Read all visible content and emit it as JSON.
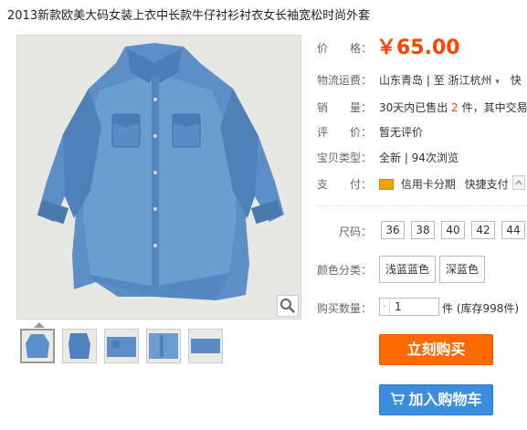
{
  "title": "2013新款欧美大码女装上衣中长款牛仔衬衫衬衣女长袖宽松时尚外套",
  "price": {
    "label": "价　　格：",
    "value": "￥65.00"
  },
  "shipping": {
    "label": "物流运费：",
    "value": "山东青岛 | 至 浙江杭州",
    "extra": "快"
  },
  "sales": {
    "label": "销　　量：",
    "prefix": "30天内已售出",
    "num": "2",
    "suffix": "件，其中交易"
  },
  "rating": {
    "label": "评　　价：",
    "value": "暂无评价"
  },
  "status": {
    "label": "宝贝类型：",
    "value": "全新 | 94次浏览"
  },
  "payment": {
    "label": "支　　付：",
    "opt1": "信用卡分期",
    "opt2": "快捷支付"
  },
  "size": {
    "label": "尺码：",
    "options": [
      "36",
      "38",
      "40",
      "42",
      "44"
    ]
  },
  "color": {
    "label": "颜色分类：",
    "options": [
      "浅蓝蓝色",
      "深蓝色"
    ]
  },
  "quantity": {
    "label": "购买数量：",
    "minus": "-",
    "value": "1",
    "suffix": "件 (库存998件)"
  },
  "buttons": {
    "buy": "立刻购买",
    "cart": "加入购物车"
  },
  "icons": {
    "zoom": "magnifier-icon",
    "cart": "cart-icon",
    "card": "credit-card-icon"
  }
}
